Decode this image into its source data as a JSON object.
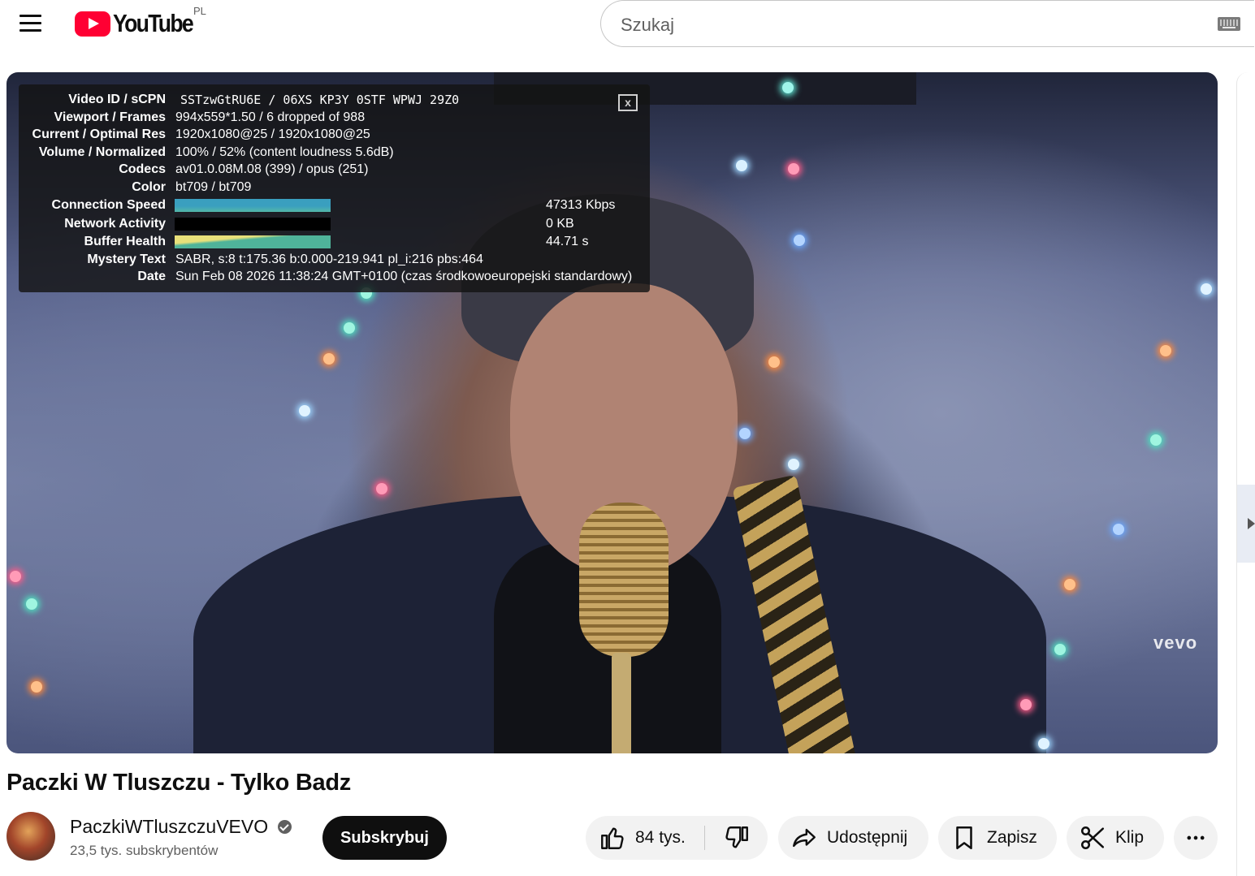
{
  "header": {
    "logo_text": "YouTube",
    "country_code": "PL",
    "search_placeholder": "Szukaj"
  },
  "player": {
    "watermark": "vevo",
    "stats": {
      "rows": [
        {
          "label": "Video ID / sCPN",
          "value": "SSTzwGtRU6E / 06XS KP3Y 0STF WPWJ 29Z0"
        },
        {
          "label": "Viewport / Frames",
          "value": "994x559*1.50 / 6 dropped of 988"
        },
        {
          "label": "Current / Optimal Res",
          "value": "1920x1080@25 / 1920x1080@25"
        },
        {
          "label": "Volume / Normalized",
          "value": "100% / 52% (content loudness 5.6dB)"
        },
        {
          "label": "Codecs",
          "value": "av01.0.08M.08 (399) / opus (251)"
        },
        {
          "label": "Color",
          "value": "bt709 / bt709"
        },
        {
          "label": "Connection Speed",
          "value": "47313 Kbps"
        },
        {
          "label": "Network Activity",
          "value": "0 KB"
        },
        {
          "label": "Buffer Health",
          "value": "44.71 s"
        },
        {
          "label": "Mystery Text",
          "value": "SABR, s:8 t:175.36 b:0.000-219.941 pl_i:216 pbs:464"
        },
        {
          "label": "Date",
          "value": "Sun Feb 08 2026 11:38:24 GMT+0100 (czas środkowoeuropejski standardowy)"
        }
      ],
      "close_label": "x",
      "colors": {
        "connection": "#3a9fbf",
        "buffer": "#e8e07a",
        "buffer_fill": "#4fb39a"
      }
    }
  },
  "video": {
    "title": "Paczki W Tluszczu - Tylko Badz",
    "channel_name": "PaczkiWTluszczuVEVO",
    "subscribers": "23,5 tys. subskrybentów",
    "subscribe_label": "Subskrybuj",
    "likes": "84 tys.",
    "share_label": "Udostępnij",
    "save_label": "Zapisz",
    "clip_label": "Klip"
  },
  "icons": [
    "menu-icon",
    "youtube-logo-icon",
    "keyboard-icon",
    "verified-icon",
    "thumbs-up-icon",
    "thumbs-down-icon",
    "share-icon",
    "bookmark-icon",
    "scissors-icon",
    "more-icon",
    "chevron-right-icon"
  ]
}
